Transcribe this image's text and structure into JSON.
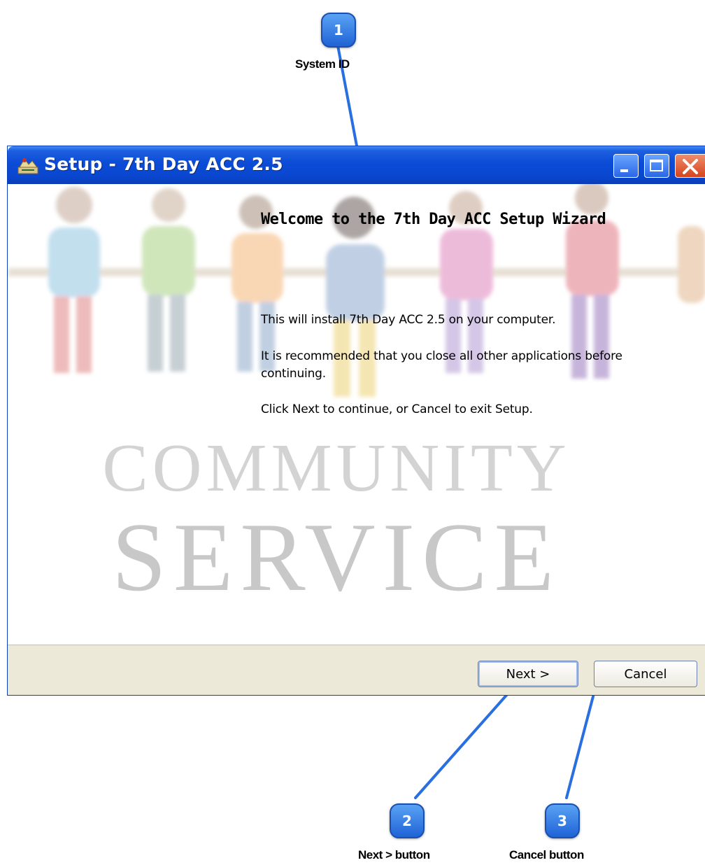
{
  "callouts": [
    {
      "number": "1",
      "label": "System ID"
    },
    {
      "number": "2",
      "label": "Next > button"
    },
    {
      "number": "3",
      "label": "Cancel button"
    }
  ],
  "window": {
    "title": "Setup - 7th Day ACC 2.5",
    "icons": [
      "installer-app-icon",
      "minimize-icon",
      "maximize-icon",
      "close-icon"
    ]
  },
  "content": {
    "heading": "Welcome to the 7th Day ACC Setup Wizard",
    "paragraph1": "This will install 7th Day ACC 2.5 on your computer.",
    "paragraph2": "It is recommended that you close all other applications before continuing.",
    "paragraph3": "Click Next to continue, or Cancel to exit Setup.",
    "background_words": [
      "COMMUNITY",
      "SERVICE"
    ]
  },
  "buttons": {
    "next": "Next >",
    "cancel": "Cancel"
  },
  "colors": {
    "titlebar": "#0b4bd6",
    "marker": "#2c74e8",
    "footer": "#ece9d8"
  }
}
